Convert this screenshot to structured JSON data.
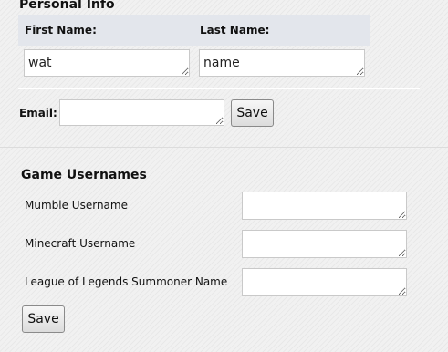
{
  "personal": {
    "title": "Personal Info",
    "first_name_label": "First Name:",
    "last_name_label": "Last Name:",
    "first_name_value": "wat",
    "last_name_value": "name",
    "email_label": "Email:",
    "email_value": "",
    "save_label": "Save"
  },
  "games": {
    "title": "Game Usernames",
    "mumble_label": "Mumble Username",
    "minecraft_label": "Minecraft Username",
    "lol_label": "League of Legends Summoner Name",
    "mumble_value": "",
    "minecraft_value": "",
    "lol_value": "",
    "save_label": "Save"
  }
}
